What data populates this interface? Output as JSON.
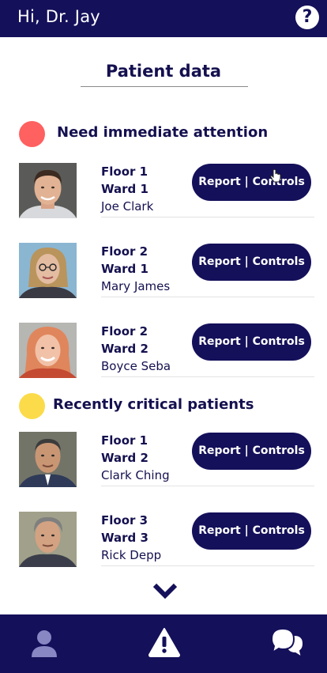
{
  "header": {
    "greeting": "Hi, Dr. Jay",
    "help_icon": "question-circle-icon",
    "help_glyph": "?"
  },
  "page": {
    "title": "Patient data"
  },
  "sections": [
    {
      "label": "Need immediate attention",
      "dot_color": "#ff6060",
      "patients": [
        {
          "floor": "Floor 1",
          "ward": "Ward 1",
          "name": "Joe Clark",
          "button": "Report | Controls"
        },
        {
          "floor": "Floor 2",
          "ward": "Ward 1",
          "name": "Mary James",
          "button": "Report | Controls"
        },
        {
          "floor": "Floor 2",
          "ward": "Ward 2",
          "name": "Boyce Seba",
          "button": "Report | Controls"
        }
      ]
    },
    {
      "label": "Recently critical patients",
      "dot_color": "#fbdb4a",
      "patients": [
        {
          "floor": "Floor 1",
          "ward": "Ward 2",
          "name": "Clark Ching",
          "button": "Report | Controls"
        },
        {
          "floor": "Floor 3",
          "ward": "Ward 3",
          "name": "Rick Depp",
          "button": "Report | Controls"
        }
      ]
    }
  ],
  "scroll_more_icon": "chevron-down-icon",
  "bottom_nav": [
    {
      "icon": "user-icon"
    },
    {
      "icon": "alert-triangle-icon"
    },
    {
      "icon": "chat-bubbles-icon"
    }
  ],
  "colors": {
    "brand": "#14105a",
    "urgent": "#ff6060",
    "warning": "#fbdb4a"
  }
}
